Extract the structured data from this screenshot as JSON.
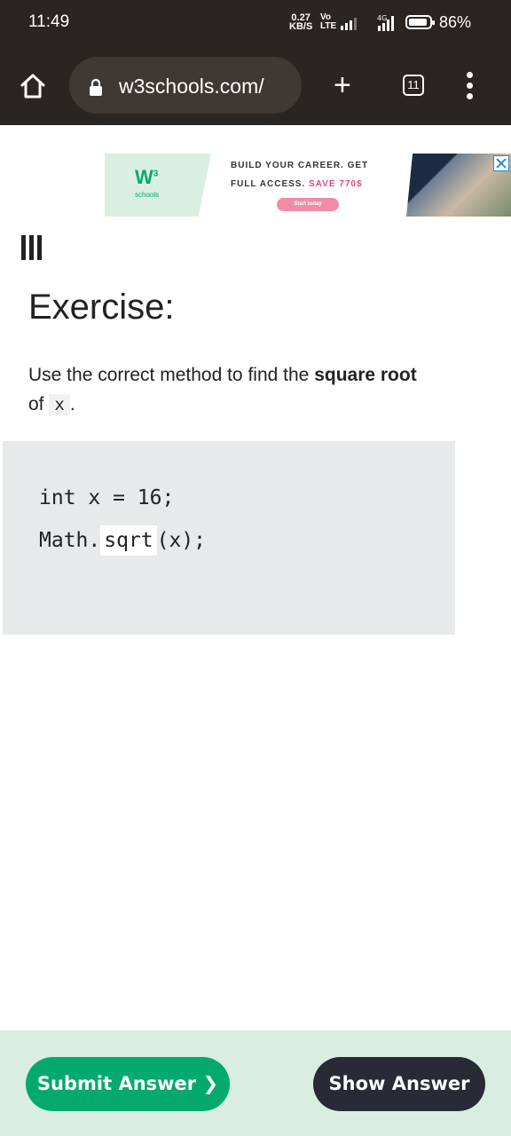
{
  "status_bar": {
    "time": "11:49",
    "net_speed_value": "0.27",
    "net_speed_unit": "KB/S",
    "volte_top": "Vo",
    "volte_bottom": "LTE",
    "network_type": "4G",
    "battery_level": 0.86,
    "battery_percent": "86%"
  },
  "browser": {
    "url": "w3schools.com/",
    "tab_count": "11",
    "icons": [
      "home-icon",
      "lock-icon",
      "plus-icon",
      "tabs-icon",
      "overflow-menu-icon"
    ]
  },
  "ad": {
    "logo_text": "W",
    "logo_sup": "3",
    "logo_sub": "schools",
    "line1": "BUILD YOUR CAREER. GET",
    "line2": "FULL ACCESS.",
    "line2_highlight": "SAVE 770$",
    "cta": "Start today"
  },
  "exercise": {
    "title": "Exercise:",
    "instruction_prefix": "Use the correct method to find the",
    "instruction_bold": "square root",
    "instruction_mid": "of",
    "instruction_code": "x",
    "instruction_suffix": ".",
    "code_line1": "int x = 16;",
    "code_line2_prefix": "Math.",
    "code_answer_value": "sqrt",
    "code_line2_suffix": "(x);"
  },
  "actions": {
    "submit_label": "Submit Answer ❯",
    "show_label": "Show Answer"
  },
  "colors": {
    "chrome_bg": "#2a2521",
    "url_pill": "#403832",
    "accent_green": "#04aa6d",
    "bottom_bar": "#d9eee1",
    "dark_button": "#282a35",
    "code_bg": "#e7e9eb"
  }
}
